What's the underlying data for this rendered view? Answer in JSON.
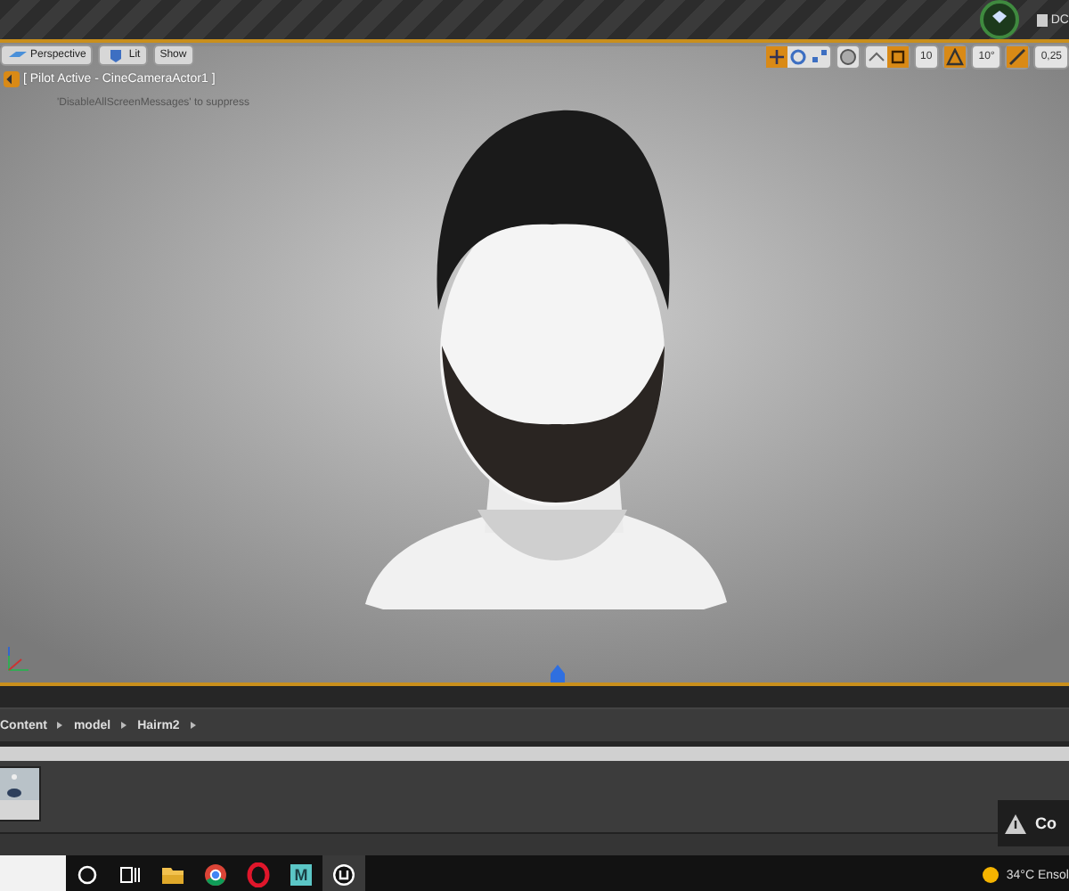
{
  "title_bar": {
    "right_label": "DC"
  },
  "viewport": {
    "view_buttons": [
      {
        "kind": "perspective",
        "label": "Perspective"
      },
      {
        "kind": "lit",
        "label": "Lit"
      },
      {
        "kind": "show",
        "label": "Show"
      }
    ],
    "pilot_label": "[ Pilot Active - CineCameraActor1 ]",
    "message": "'DisableAllScreenMessages' to suppress",
    "transform_tools": [
      {
        "kind": "translate",
        "selected": true
      },
      {
        "kind": "rotate",
        "selected": false
      },
      {
        "kind": "scale",
        "selected": false
      }
    ],
    "snaps": [
      {
        "kind": "grid",
        "on": true,
        "value": "10"
      },
      {
        "kind": "rotation",
        "on": true,
        "value": "10°"
      },
      {
        "kind": "scale",
        "on": true,
        "value": "0,25"
      }
    ]
  },
  "content_browser": {
    "breadcrumb": [
      "Content",
      "model",
      "Hairm2"
    ]
  },
  "toast": {
    "text": "Co"
  },
  "taskbar": {
    "apps": [
      {
        "kind": "folder",
        "active": false
      },
      {
        "kind": "browser",
        "active": false
      },
      {
        "kind": "opera",
        "active": false
      },
      {
        "kind": "letter",
        "label": "M",
        "active": false
      },
      {
        "kind": "unreal",
        "active": true
      }
    ],
    "weather": "34°C  Ensol"
  }
}
